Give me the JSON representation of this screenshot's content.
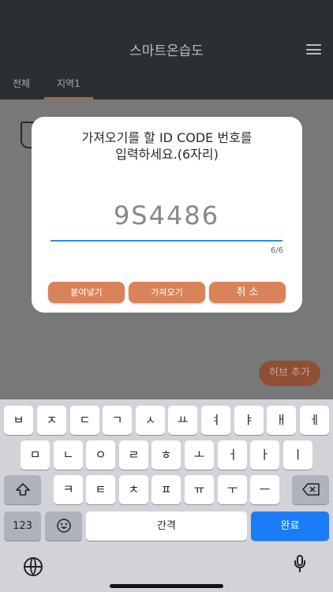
{
  "header": {
    "title": "스마트온습도",
    "menu_icon": "hamburger-menu-icon"
  },
  "tabs": [
    {
      "label": "전체",
      "selected": false
    },
    {
      "label": "지역1",
      "selected": true
    }
  ],
  "content": {
    "hub_add_label": "허브 추가",
    "device_icon": "device-plug-icon"
  },
  "dialog": {
    "message_line1": "가져오기를 할 ID CODE 번호를",
    "message_line2": "입력하세요.(6자리)",
    "code_value": "9S4486",
    "counter": "6/6",
    "paste_label": "붙여넣기",
    "import_label": "가져오기",
    "cancel_label": "취 소"
  },
  "keyboard": {
    "row1": [
      "ㅂ",
      "ㅈ",
      "ㄷ",
      "ㄱ",
      "ㅅ",
      "ㅛ",
      "ㅕ",
      "ㅑ",
      "ㅐ",
      "ㅔ"
    ],
    "row2": [
      "ㅁ",
      "ㄴ",
      "ㅇ",
      "ㄹ",
      "ㅎ",
      "ㅗ",
      "ㅓ",
      "ㅏ",
      "ㅣ"
    ],
    "row3": [
      "ㅋ",
      "ㅌ",
      "ㅊ",
      "ㅍ",
      "ㅠ",
      "ㅜ",
      "ㅡ"
    ],
    "shift_icon": "shift-icon",
    "backspace_icon": "backspace-icon",
    "numbers_label": "123",
    "emoji_icon": "emoji-icon",
    "space_label": "간격",
    "return_label": "완료",
    "globe_icon": "globe-icon",
    "mic_icon": "microphone-icon"
  },
  "colors": {
    "header_bg": "#2b2f33",
    "accent_orange": "#d9835a",
    "input_underline": "#2a90d9",
    "return_key": "#1a7df5"
  }
}
